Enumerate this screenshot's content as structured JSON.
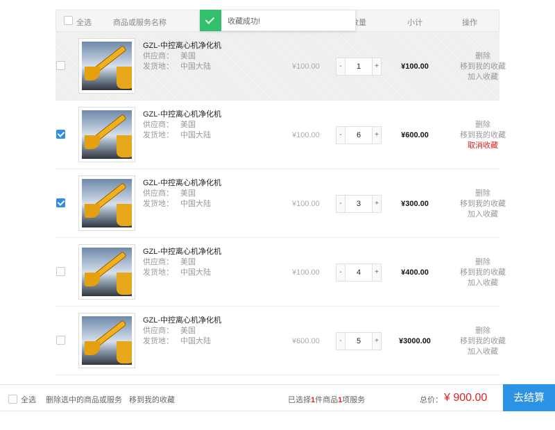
{
  "header": {
    "select_all": "全选",
    "col_name": "商品或服务名称",
    "col_qty": "数量",
    "col_subtotal": "小计",
    "col_ops": "操作"
  },
  "toast": {
    "message": "收藏成功!"
  },
  "items": [
    {
      "checked": false,
      "name": "GZL-中控离心机净化机",
      "supplier_label": "供应商：",
      "supplier": "美国",
      "origin_label": "发货地：",
      "origin": "中国大陆",
      "price": "¥100.00",
      "qty_minus": "-",
      "qty": "1",
      "qty_plus": "+",
      "subtotal": "¥100.00",
      "op_delete": "删除",
      "op_move": "移到我的收藏",
      "op_fav": "加入收藏",
      "fav_active": false
    },
    {
      "checked": true,
      "name": "GZL-中控离心机净化机",
      "supplier_label": "供应商：",
      "supplier": "美国",
      "origin_label": "发货地：",
      "origin": "中国大陆",
      "price": "¥100.00",
      "qty_minus": "-",
      "qty": "6",
      "qty_plus": "+",
      "subtotal": "¥600.00",
      "op_delete": "删除",
      "op_move": "移到我的收藏",
      "op_fav": "取消收藏",
      "fav_active": true
    },
    {
      "checked": true,
      "name": "GZL-中控离心机净化机",
      "supplier_label": "供应商：",
      "supplier": "美国",
      "origin_label": "发货地：",
      "origin": "中国大陆",
      "price": "¥100.00",
      "qty_minus": "-",
      "qty": "3",
      "qty_plus": "+",
      "subtotal": "¥300.00",
      "op_delete": "删除",
      "op_move": "移到我的收藏",
      "op_fav": "加入收藏",
      "fav_active": false
    },
    {
      "checked": false,
      "name": "GZL-中控离心机净化机",
      "supplier_label": "供应商：",
      "supplier": "美国",
      "origin_label": "发货地：",
      "origin": "中国大陆",
      "price": "¥100.00",
      "qty_minus": "-",
      "qty": "4",
      "qty_plus": "+",
      "subtotal": "¥400.00",
      "op_delete": "删除",
      "op_move": "移到我的收藏",
      "op_fav": "加入收藏",
      "fav_active": false
    },
    {
      "checked": false,
      "name": "GZL-中控离心机净化机",
      "supplier_label": "供应商：",
      "supplier": "美国",
      "origin_label": "发货地：",
      "origin": "中国大陆",
      "price": "¥600.00",
      "qty_minus": "-",
      "qty": "5",
      "qty_plus": "+",
      "subtotal": "¥3000.00",
      "op_delete": "删除",
      "op_move": "移到我的收藏",
      "op_fav": "加入收藏",
      "fav_active": false
    }
  ],
  "footer": {
    "select_all": "全选",
    "delete_selected": "删除选中的商品或服务",
    "move_to_fav": "移到我的收藏",
    "selected_prefix": "已选择",
    "selected_goods": "1",
    "selected_goods_unit": "件商品",
    "selected_services": "1",
    "selected_services_unit": "项服务",
    "total_label": "总价：",
    "total_amount": "¥ 900.00",
    "checkout": "去结算"
  },
  "colors": {
    "accent_blue": "#2b93e6",
    "price_red": "#e02020",
    "toast_green": "#33c06d"
  }
}
